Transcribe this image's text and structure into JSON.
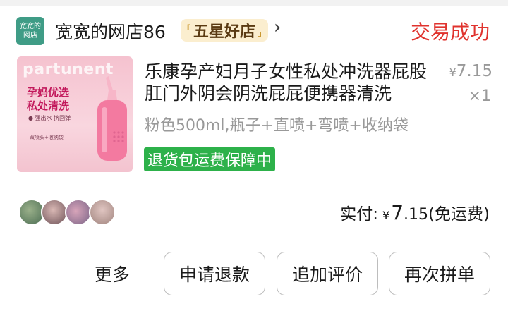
{
  "shop": {
    "logo_text": "宽宽的网店",
    "name": "宽宽的网店86",
    "badge": "五星好店",
    "order_status": "交易成功"
  },
  "product": {
    "image_brand": "partunent",
    "image_tag_1": "孕妈优选",
    "image_tag_2": "私处清洗",
    "image_tag_3": "● 强出水 挤回弹",
    "image_tag_4": "双喷头+收纳袋",
    "title": "乐康孕产妇月子女性私处冲洗器屁股肛门外阴会阴洗屁屁便携器清洗",
    "unit_price_symbol": "¥",
    "unit_price": "7.15",
    "quantity": "×1",
    "sku": "粉色500ml,瓶子+直喷+弯喷+收纳袋",
    "guarantee": "退货包运费保障中"
  },
  "payment": {
    "label": "实付:",
    "currency": "¥",
    "amount_int": "7",
    "amount_dec": ".15",
    "shipping_note": "(免运费)"
  },
  "actions": {
    "more": "更多",
    "refund": "申请退款",
    "add_review": "追加评价",
    "rebuy": "再次拼单"
  },
  "colors": {
    "status_red": "#e0332e",
    "guarantee_green": "#2db14a",
    "badge_bg": "#fbeecf"
  }
}
